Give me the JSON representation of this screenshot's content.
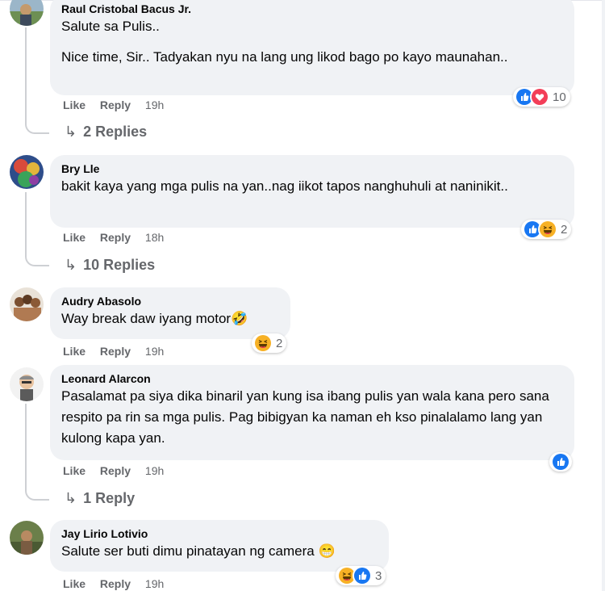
{
  "labels": {
    "like": "Like",
    "reply": "Reply"
  },
  "comments": [
    {
      "author": "Raul Cristobal Bacus Jr.",
      "lines": [
        "Salute sa Pulis..",
        "Nice time, Sir.. Tadyakan nyu na lang ung likod bago po kayo maunahan.."
      ],
      "time": "19h",
      "reaction_count": "10",
      "reactions": [
        "like-icon",
        "love-icon"
      ],
      "replies": "2 Replies"
    },
    {
      "author": "Bry Lle",
      "lines": [
        "bakit kaya yang mga pulis na yan..nag iikot tapos nanghuhuli at naninikit.."
      ],
      "time": "18h",
      "reaction_count": "2",
      "reactions": [
        "like-icon",
        "haha-icon"
      ],
      "replies": "10 Replies"
    },
    {
      "author": "Audry Abasolo",
      "lines": [
        "Way break daw iyang motor🤣"
      ],
      "time": "19h",
      "reaction_count": "2",
      "reactions": [
        "haha-icon"
      ]
    },
    {
      "author": "Leonard Alarcon",
      "lines": [
        "Pasalamat pa siya dika binaril yan kung isa ibang pulis yan wala kana pero sana respito pa rin sa mga pulis. Pag bibigyan ka naman eh kso pinalalamo lang yan kulong kapa yan."
      ],
      "time": "19h",
      "reactions": [
        "like-icon"
      ],
      "replies": "1 Reply"
    },
    {
      "author": "Jay Lirio Lotivio",
      "lines": [
        "Salute ser buti dimu pinatayan ng camera 😁"
      ],
      "time": "19h",
      "reaction_count": "3",
      "reactions": [
        "haha-icon",
        "like-icon"
      ]
    }
  ],
  "colors": {
    "like": "#1877f2",
    "love": "#f33e58",
    "haha": "#f7b125",
    "bubble": "#f0f2f5",
    "meta": "#65676b"
  }
}
